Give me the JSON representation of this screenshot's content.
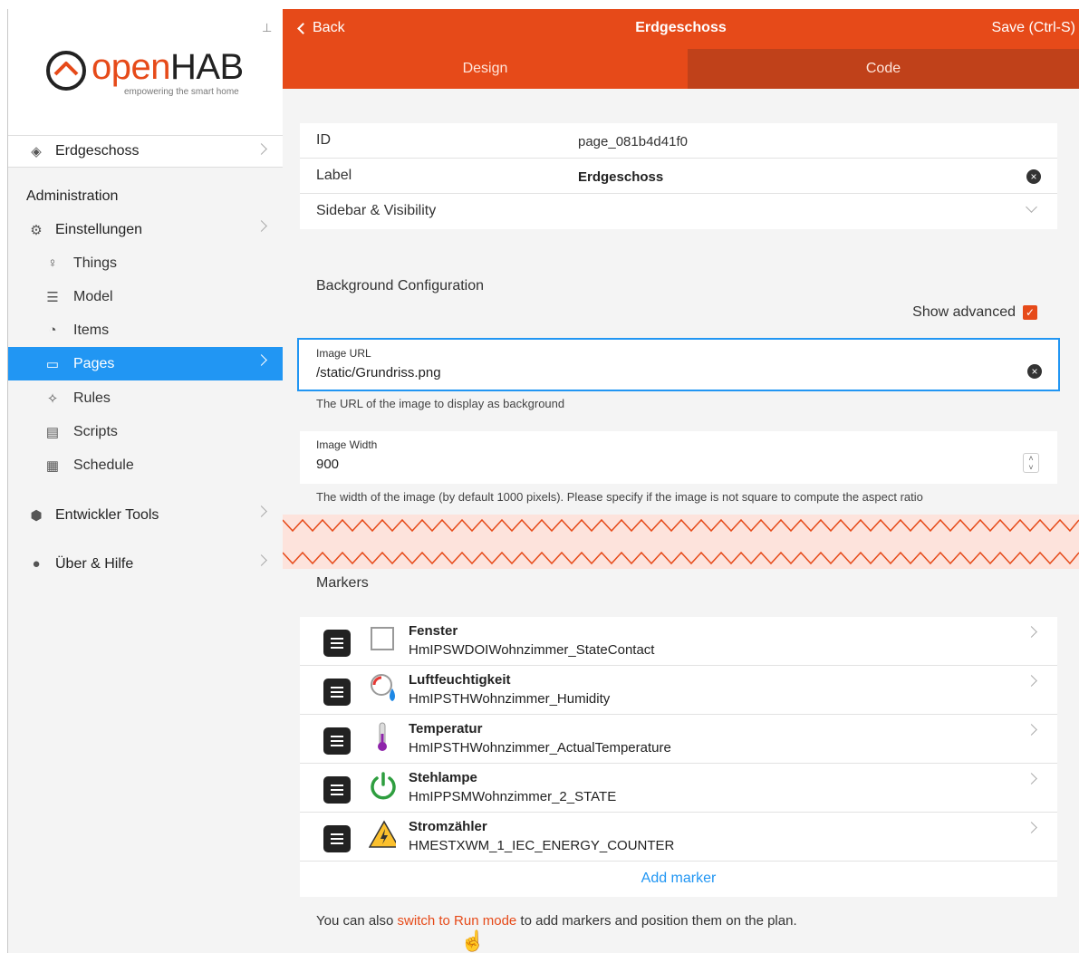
{
  "header": {
    "back_label": "Back",
    "title": "Erdgeschoss",
    "save_label": "Save (Ctrl-S)",
    "tabs": [
      "Design",
      "Code"
    ]
  },
  "sidebar": {
    "logo_open": "open",
    "logo_hab": "HAB",
    "logo_tagline": "empowering the smart home",
    "current_page": "Erdgeschoss",
    "admin_heading": "Administration",
    "items": [
      {
        "label": "Einstellungen",
        "icon": "gear-icon"
      },
      {
        "label": "Things",
        "icon": "lightbulb-icon"
      },
      {
        "label": "Model",
        "icon": "list-icon"
      },
      {
        "label": "Items",
        "icon": "items-icon"
      },
      {
        "label": "Pages",
        "icon": "monitor-icon"
      },
      {
        "label": "Rules",
        "icon": "magic-icon"
      },
      {
        "label": "Scripts",
        "icon": "script-icon"
      },
      {
        "label": "Schedule",
        "icon": "calendar-icon"
      },
      {
        "label": "Entwickler Tools",
        "icon": "shield-icon"
      },
      {
        "label": "Über & Hilfe",
        "icon": "help-icon"
      }
    ]
  },
  "page": {
    "id_label": "ID",
    "id_value": "page_081b4d41f0",
    "label_label": "Label",
    "label_value": "Erdgeschoss",
    "sidebar_visibility": "Sidebar & Visibility",
    "bg_config_title": "Background Configuration",
    "show_advanced": "Show advanced",
    "image_url_label": "Image URL",
    "image_url_value": "/static/Grundriss.png",
    "image_url_hint": "The URL of the image to display as background",
    "image_width_label": "Image Width",
    "image_width_value": "900",
    "image_width_hint": "The width of the image (by default 1000 pixels). Please specify if the image is not square to compute the aspect ratio",
    "markers_title": "Markers",
    "add_marker": "Add marker",
    "run_hint_before": "You can also ",
    "run_hint_link": "switch to Run mode",
    "run_hint_after": " to add markers and position them on the plan."
  },
  "markers": [
    {
      "name": "Fenster",
      "item": "HmIPSWDOIWohnzimmer_StateContact",
      "icon": "window-icon"
    },
    {
      "name": "Luftfeuchtigkeit",
      "item": "HmIPSTHWohnzimmer_Humidity",
      "icon": "humidity-icon"
    },
    {
      "name": "Temperatur",
      "item": "HmIPSTHWohnzimmer_ActualTemperature",
      "icon": "thermometer-icon"
    },
    {
      "name": "Stehlampe",
      "item": "HmIPPSMWohnzimmer_2_STATE",
      "icon": "power-icon"
    },
    {
      "name": "Stromzähler",
      "item": "HMESTXWM_1_IEC_ENERGY_COUNTER",
      "icon": "warning-icon"
    }
  ],
  "colors": {
    "accent": "#e64a19",
    "active": "#2196f3"
  }
}
